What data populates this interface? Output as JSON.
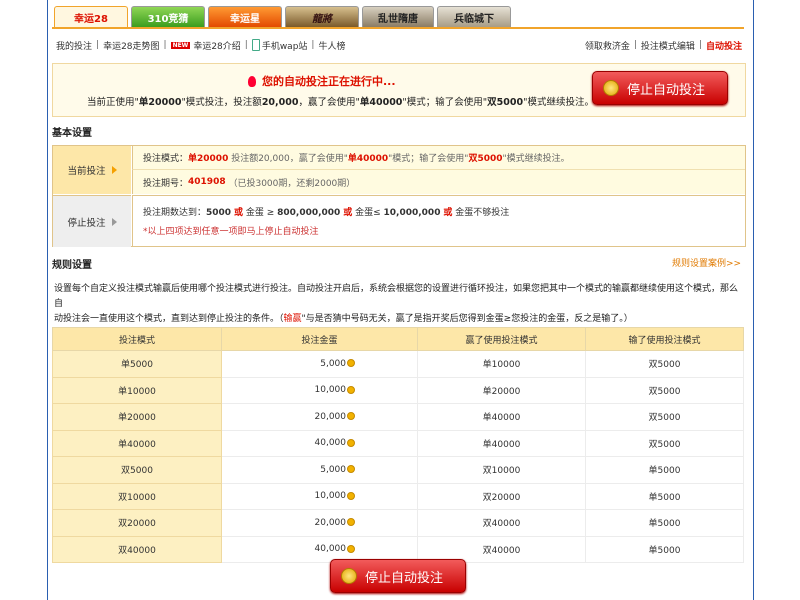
{
  "tabs": [
    {
      "label": "幸运28"
    },
    {
      "label": "310竞猜"
    },
    {
      "label": "幸运星"
    },
    {
      "label": "龍將"
    },
    {
      "label": "乱世隋唐"
    },
    {
      "label": "兵临城下"
    }
  ],
  "subnav": {
    "left": [
      "我的投注",
      "幸运28走势图",
      "幸运28介绍",
      "手机wap站",
      "牛人榜"
    ],
    "new_tag": "NEW",
    "right": [
      "领取救济金",
      "投注模式编辑",
      "自动投注"
    ]
  },
  "banner": {
    "headline": "您的自动投注正在进行中...",
    "desc_prefix": "当前正使用\"",
    "mode": "单20000",
    "desc_mid1": "\"模式投注，投注额",
    "amount": "20,000",
    "desc_mid2": "，赢了会使用\"",
    "win_mode": "单40000",
    "desc_mid3": "\"模式；输了会使用\"",
    "lose_mode": "双5000",
    "desc_suffix": "\"模式继续投注。",
    "stop_label": "停止自动投注"
  },
  "basic": {
    "title": "基本设置",
    "current_label": "当前投注",
    "stop_label": "停止投注",
    "row1_prefix": "投注模式：",
    "row1_mode": "单20000",
    "row1_a": "投注额20,000，赢了会使用\"",
    "row1_win": "单40000",
    "row1_b": "\"模式；输了会使用\"",
    "row1_lose": "双5000",
    "row1_c": "\"模式继续投注。",
    "row2_prefix": "投注期号：",
    "row2_issue": "401908",
    "row2_note": "（已投3000期，还剩2000期）",
    "stop_line_parts": {
      "a": "投注期数达到：",
      "b": "5000",
      "or1": "或",
      "c": "金蛋 ≥",
      "d": "800,000,000",
      "or2": "或",
      "e": "金蛋≤",
      "f": "10,000,000",
      "or3": "或",
      "g": "金蛋不够投注"
    },
    "stop_note": "*以上四项达到任意一项即马上停止自动投注"
  },
  "rules": {
    "title": "规则设置",
    "link": "规则设置案例>>",
    "desc1": "设置每个自定义投注模式输赢后使用哪个投注模式进行投注。自动投注开启后，系统会根据您的设置进行循环投注，如果您把其中一个模式的输赢都继续使用这个模式，那么自",
    "desc2a": "动投注会一直使用这个模式，直到达到停止投注的条件。（",
    "desc2_hl": "输赢",
    "desc2b": "\"与是否猜中号码无关，赢了是指开奖后您得到金蛋≥您投注的金蛋，反之是输了。）"
  },
  "table": {
    "headers": [
      "投注模式",
      "投注金蛋",
      "赢了使用投注模式",
      "输了使用投注模式"
    ],
    "rows": [
      {
        "mode": "单5000",
        "amount": "5,000",
        "win": "单10000",
        "lose": "双5000"
      },
      {
        "mode": "单10000",
        "amount": "10,000",
        "win": "单20000",
        "lose": "双5000"
      },
      {
        "mode": "单20000",
        "amount": "20,000",
        "win": "单40000",
        "lose": "双5000"
      },
      {
        "mode": "单40000",
        "amount": "40,000",
        "win": "单40000",
        "lose": "双5000"
      },
      {
        "mode": "双5000",
        "amount": "5,000",
        "win": "双10000",
        "lose": "单5000"
      },
      {
        "mode": "双10000",
        "amount": "10,000",
        "win": "双20000",
        "lose": "单5000"
      },
      {
        "mode": "双20000",
        "amount": "20,000",
        "win": "双40000",
        "lose": "单5000"
      },
      {
        "mode": "双40000",
        "amount": "40,000",
        "win": "双40000",
        "lose": "单5000"
      }
    ]
  },
  "bottom_button": "停止自动投注",
  "colors": {
    "accent": "#dd1100",
    "tab_border": "#f1a42b",
    "header_bg": "#fde7a8",
    "button_red": "#c80000"
  }
}
